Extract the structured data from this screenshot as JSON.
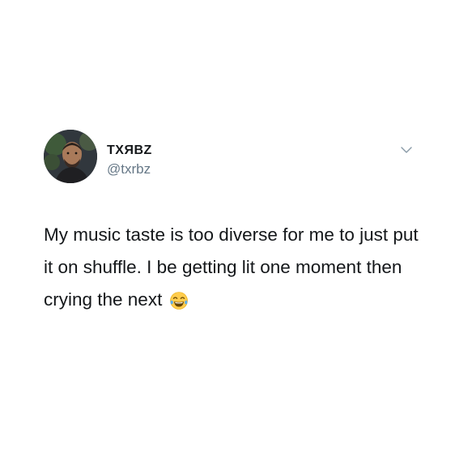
{
  "tweet": {
    "display_name": "TXЯBZ",
    "handle": "@txrbz",
    "text": "My music taste is too diverse for me to just put it on shuffle. I be getting lit one moment then crying the next",
    "emoji": "face-with-tears-of-joy",
    "menu_icon": "chevron-down-icon"
  },
  "colors": {
    "text": "#14171a",
    "secondary": "#657786",
    "background": "#ffffff"
  }
}
